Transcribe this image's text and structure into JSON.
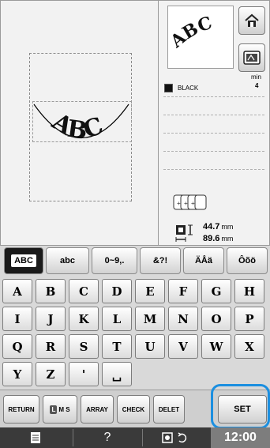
{
  "preview": {
    "arc_text": "ABC",
    "thumbnail_text": "ABC"
  },
  "side_buttons": {
    "home_icon": "home-icon",
    "hoop_icon": "embroidery-hoop-icon"
  },
  "thread": {
    "color_name": "BLACK",
    "color_hex": "#111111",
    "time_label": "min",
    "time_value": "4"
  },
  "size": {
    "height_value": "44.7",
    "width_value": "89.6",
    "unit": "mm"
  },
  "tabs": [
    {
      "label": "ABC",
      "active": true
    },
    {
      "label": "abc",
      "active": false
    },
    {
      "label": "0~9,.",
      "active": false
    },
    {
      "label": "&?!",
      "active": false
    },
    {
      "label": "ÄÅä",
      "active": false
    },
    {
      "label": "Ôõö",
      "active": false
    }
  ],
  "keys": [
    "A",
    "B",
    "C",
    "D",
    "E",
    "F",
    "G",
    "H",
    "I",
    "J",
    "K",
    "L",
    "M",
    "N",
    "O",
    "P",
    "Q",
    "R",
    "S",
    "T",
    "U",
    "V",
    "W",
    "X",
    "Y",
    "Z",
    "'",
    "␣"
  ],
  "actions": {
    "return_label": "RETURN",
    "lms_label": "L M S",
    "lms_prefix": "L",
    "lms_rest": "M S",
    "array_label": "ARRAY",
    "check_label": "CHECK",
    "delete_label": "DELET",
    "set_label": "SET"
  },
  "status": {
    "help_label": "?",
    "clock": "12:00"
  },
  "colors": {
    "accent_highlight": "#1b8fe0",
    "status_bar": "#3a3a3a"
  }
}
